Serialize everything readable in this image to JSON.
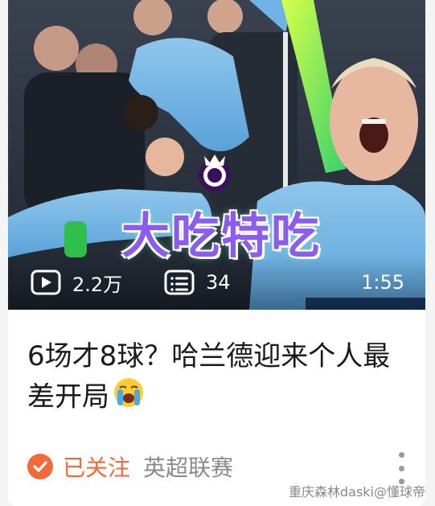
{
  "thumbnail": {
    "overlay_text": "大吃特吃",
    "views": "2.2万",
    "comments": "34",
    "duration": "1:55",
    "icons": [
      "play-count-icon",
      "comment-list-icon",
      "premier-league-logo"
    ]
  },
  "post": {
    "title": "6场才8球？哈兰德迎来个人最差开局",
    "emoji": "loudly-crying-face"
  },
  "footer": {
    "followed_label": "已关注",
    "category": "英超联赛"
  },
  "watermark": "重庆森林daski@懂球帝",
  "colors": {
    "accent_orange": "#f26a3a",
    "overlay_text": "#8b5cf0",
    "category_gray": "#8a8a8a"
  }
}
